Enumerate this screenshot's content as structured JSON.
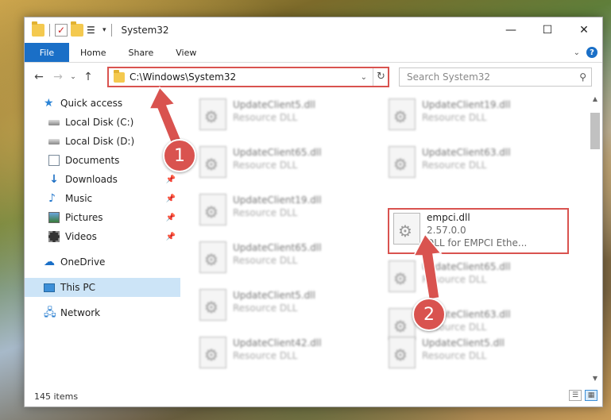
{
  "window": {
    "title": "System32",
    "controls": {
      "minimize": "—",
      "maximize": "☐",
      "close": "✕"
    }
  },
  "ribbon": {
    "file": "File",
    "tabs": [
      "Home",
      "Share",
      "View"
    ]
  },
  "address": {
    "path": "C:\\Windows\\System32",
    "search_placeholder": "Search System32"
  },
  "nav": {
    "quick_access": "Quick access",
    "items": [
      {
        "label": "Local Disk (C:)",
        "pinned": false
      },
      {
        "label": "Local Disk (D:)",
        "pinned": false
      },
      {
        "label": "Documents",
        "pinned": true
      },
      {
        "label": "Downloads",
        "pinned": true
      },
      {
        "label": "Music",
        "pinned": true
      },
      {
        "label": "Pictures",
        "pinned": true
      },
      {
        "label": "Videos",
        "pinned": true
      }
    ],
    "onedrive": "OneDrive",
    "this_pc": "This PC",
    "network": "Network"
  },
  "files": [
    {
      "name": "UpdateClient5.dll",
      "sub": "Resource DLL"
    },
    {
      "name": "UpdateClient19.dll",
      "sub": "Resource DLL"
    },
    {
      "name": "UpdateClient65.dll",
      "sub": "Resource DLL"
    },
    {
      "name": "UpdateClient63.dll",
      "sub": "Resource DLL"
    },
    {
      "name": "UpdateClient19.dll",
      "sub": "Resource DLL"
    },
    {
      "name": "empci.dll",
      "sub": "2.57.0.0",
      "sub2": "DLL for EMPCI  Ethe..."
    },
    {
      "name": "UpdateClient65.dll",
      "sub": "Resource DLL"
    },
    {
      "name": "UpdateClient65.dll",
      "sub": "Resource DLL"
    },
    {
      "name": "UpdateClient5.dll",
      "sub": "Resource DLL"
    },
    {
      "name": "UpdateClient63.dll",
      "sub": "Resource DLL"
    },
    {
      "name": "UpdateClient42.dll",
      "sub": "Resource DLL"
    },
    {
      "name": "UpdateClient5.dll",
      "sub": "Resource DLL"
    }
  ],
  "status": {
    "items": "145 items"
  },
  "callouts": {
    "one": "1",
    "two": "2"
  },
  "colors": {
    "accent": "#1a6fc7",
    "highlight": "#d9534f",
    "selected": "#cce4f7"
  }
}
